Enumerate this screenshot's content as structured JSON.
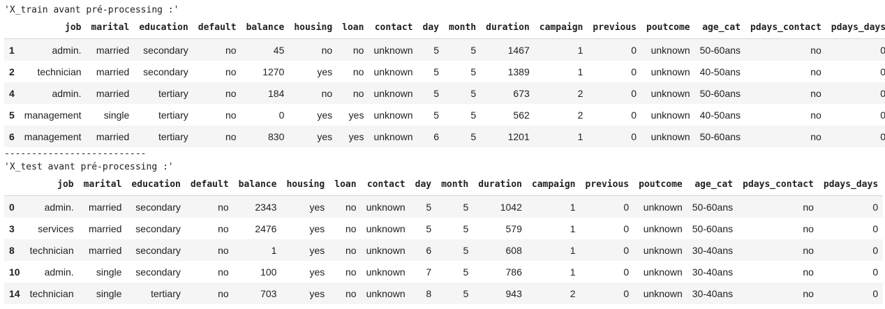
{
  "train": {
    "title": "'X_train avant pré-processing :'",
    "columns": [
      "",
      "job",
      "marital",
      "education",
      "default",
      "balance",
      "housing",
      "loan",
      "contact",
      "day",
      "month",
      "duration",
      "campaign",
      "previous",
      "poutcome",
      "age_cat",
      "pdays_contact",
      "pdays_days"
    ],
    "rows": [
      [
        "1",
        "admin.",
        "married",
        "secondary",
        "no",
        "45",
        "no",
        "no",
        "unknown",
        "5",
        "5",
        "1467",
        "1",
        "0",
        "unknown",
        "50-60ans",
        "no",
        "0"
      ],
      [
        "2",
        "technician",
        "married",
        "secondary",
        "no",
        "1270",
        "yes",
        "no",
        "unknown",
        "5",
        "5",
        "1389",
        "1",
        "0",
        "unknown",
        "40-50ans",
        "no",
        "0"
      ],
      [
        "4",
        "admin.",
        "married",
        "tertiary",
        "no",
        "184",
        "no",
        "no",
        "unknown",
        "5",
        "5",
        "673",
        "2",
        "0",
        "unknown",
        "50-60ans",
        "no",
        "0"
      ],
      [
        "5",
        "management",
        "single",
        "tertiary",
        "no",
        "0",
        "yes",
        "yes",
        "unknown",
        "5",
        "5",
        "562",
        "2",
        "0",
        "unknown",
        "40-50ans",
        "no",
        "0"
      ],
      [
        "6",
        "management",
        "married",
        "tertiary",
        "no",
        "830",
        "yes",
        "yes",
        "unknown",
        "6",
        "5",
        "1201",
        "1",
        "0",
        "unknown",
        "50-60ans",
        "no",
        "0"
      ]
    ]
  },
  "separator": "--------------------------",
  "test": {
    "title": "'X_test avant pré-processing :'",
    "columns": [
      "",
      "job",
      "marital",
      "education",
      "default",
      "balance",
      "housing",
      "loan",
      "contact",
      "day",
      "month",
      "duration",
      "campaign",
      "previous",
      "poutcome",
      "age_cat",
      "pdays_contact",
      "pdays_days"
    ],
    "rows": [
      [
        "0",
        "admin.",
        "married",
        "secondary",
        "no",
        "2343",
        "yes",
        "no",
        "unknown",
        "5",
        "5",
        "1042",
        "1",
        "0",
        "unknown",
        "50-60ans",
        "no",
        "0"
      ],
      [
        "3",
        "services",
        "married",
        "secondary",
        "no",
        "2476",
        "yes",
        "no",
        "unknown",
        "5",
        "5",
        "579",
        "1",
        "0",
        "unknown",
        "50-60ans",
        "no",
        "0"
      ],
      [
        "8",
        "technician",
        "married",
        "secondary",
        "no",
        "1",
        "yes",
        "no",
        "unknown",
        "6",
        "5",
        "608",
        "1",
        "0",
        "unknown",
        "30-40ans",
        "no",
        "0"
      ],
      [
        "10",
        "admin.",
        "single",
        "secondary",
        "no",
        "100",
        "yes",
        "no",
        "unknown",
        "7",
        "5",
        "786",
        "1",
        "0",
        "unknown",
        "30-40ans",
        "no",
        "0"
      ],
      [
        "14",
        "technician",
        "single",
        "tertiary",
        "no",
        "703",
        "yes",
        "no",
        "unknown",
        "8",
        "5",
        "943",
        "2",
        "0",
        "unknown",
        "30-40ans",
        "no",
        "0"
      ]
    ]
  }
}
